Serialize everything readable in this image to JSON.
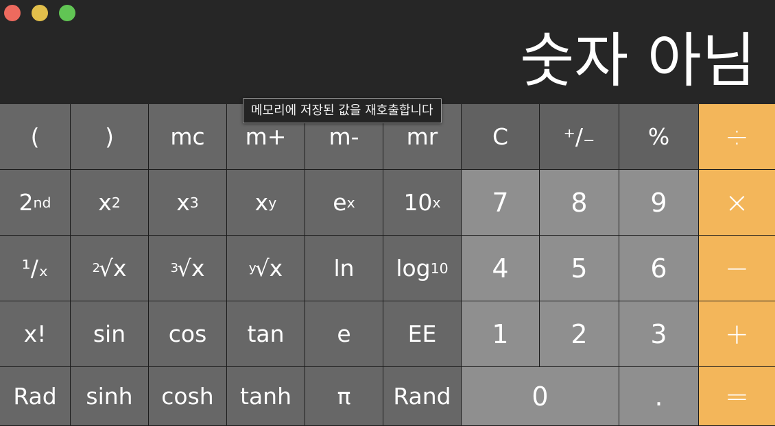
{
  "window": {
    "controls": {
      "close_color": "#ed6a5e",
      "minimize_color": "#e2bf4b",
      "zoom_color": "#61c554"
    }
  },
  "display": {
    "value": "숫자 아님"
  },
  "tooltip": {
    "text": "메모리에 저장된 값을 재호출합니다"
  },
  "keys": {
    "open_paren": "(",
    "close_paren": ")",
    "mc": "mc",
    "m_plus": "m+",
    "m_minus": "m-",
    "mr": "mr",
    "clear": "C",
    "sign": "⁺∕₋",
    "percent": "%",
    "divide": "÷",
    "second_base": "2",
    "second_sup": "nd",
    "x_squared_base": "x",
    "x_squared_sup": "2",
    "x_cubed_base": "x",
    "x_cubed_sup": "3",
    "x_pow_y_base": "x",
    "x_pow_y_sup": "y",
    "e_pow_x_base": "e",
    "e_pow_x_sup": "x",
    "ten_pow_x_base": "10",
    "ten_pow_x_sup": "x",
    "seven": "7",
    "eight": "8",
    "nine": "9",
    "multiply": "×",
    "reciprocal": "¹∕ₓ",
    "sqrt2_index": "2",
    "sqrt2_body": "√x",
    "sqrt3_index": "3",
    "sqrt3_body": "√x",
    "sqrty_index": "y",
    "sqrty_body": "√x",
    "ln": "ln",
    "log10_base": "log",
    "log10_sub": "10",
    "four": "4",
    "five": "5",
    "six": "6",
    "minus": "−",
    "factorial": "x!",
    "sin": "sin",
    "cos": "cos",
    "tan": "tan",
    "e": "e",
    "ee": "EE",
    "one": "1",
    "two": "2",
    "three": "3",
    "plus": "+",
    "rad": "Rad",
    "sinh": "sinh",
    "cosh": "cosh",
    "tanh": "tanh",
    "pi": "π",
    "rand": "Rand",
    "zero": "0",
    "decimal": ".",
    "equals": "="
  }
}
